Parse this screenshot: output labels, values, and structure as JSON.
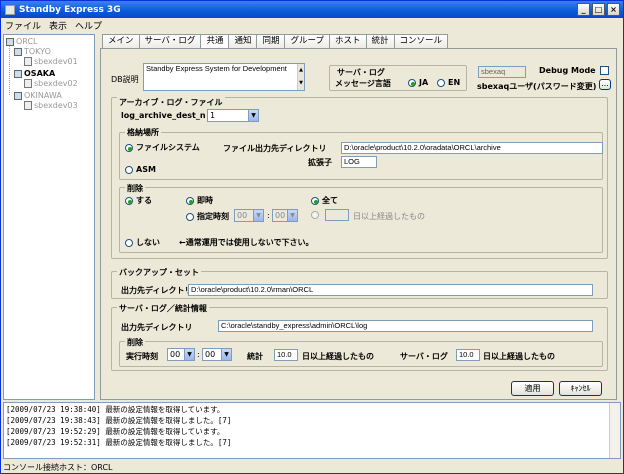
{
  "window": {
    "title": "Standby Express 3G",
    "controls": [
      "_",
      "□",
      "×"
    ]
  },
  "menu": [
    "ファイル",
    "表示",
    "ヘルプ"
  ],
  "tree": {
    "root": "ORCL",
    "nodes": [
      {
        "site": "TOKYO",
        "host": "sbexdev01",
        "active": false
      },
      {
        "site": "OSAKA",
        "host": "sbexdev02",
        "active": true
      },
      {
        "site": "OKINAWA",
        "host": "sbexdev03",
        "active": false
      }
    ]
  },
  "tabs": [
    "メイン",
    "サーバ・ログ",
    "共通",
    "通知",
    "同期",
    "グループ",
    "ホスト",
    "統計",
    "コンソール"
  ],
  "active_tab": "共通",
  "db_desc": {
    "label": "DB説明",
    "value": "Standby Express System for Development"
  },
  "server_log": {
    "label1": "サーバ・ログ",
    "label2": "メッセージ言語",
    "options": [
      "JA",
      "EN"
    ],
    "selected": "JA"
  },
  "user": {
    "value": "sbexaq",
    "label": "sbexaqユーザ(パスワード変更)",
    "button": "..."
  },
  "debug": {
    "label": "Debug Mode",
    "checked": false
  },
  "archive": {
    "title": "アーカイブ・ログ・ファイル",
    "dest_label": "log_archive_dest_n",
    "dest_value": "1",
    "storage_title": "格納場所",
    "fs_option": "ファイルシステム",
    "dir_label": "ファイル出力先ディレクトリ",
    "dir_value": "D:\\oracle\\product\\10.2.0\\oradata\\ORCL\\archive",
    "ext_label": "拡張子",
    "ext_value": "LOG",
    "asm_option": "ASM",
    "storage_selected": "ファイルシステム",
    "delete_title": "削除",
    "do_option": "する",
    "immediate_option": "即時",
    "timed_option": "指定時刻",
    "hour": "00",
    "minute": "00",
    "all_option": "全て",
    "days_suffix": "日以上経過したもの",
    "days_value": "",
    "no_option": "しない",
    "no_note": "←通常運用では使用しないで下さい。"
  },
  "backup": {
    "title": "バックアップ・セット",
    "dir_label": "出力先ディレクトリ",
    "dir_value": "D:\\oracle\\product\\10.2.0\\rman\\ORCL"
  },
  "serverlog_stats": {
    "title": "サーバ・ログ／統計情報",
    "dir_label": "出力先ディレクトリ",
    "dir_value": "C:\\oracle\\standby_express\\admin\\ORCL\\log",
    "delete_title": "削除",
    "time_label": "実行時刻",
    "hour": "00",
    "minute": "00",
    "stats_label": "統計",
    "stats_days": "10.0",
    "days_suffix": "日以上経過したもの",
    "slog_label": "サーバ・ログ",
    "slog_days": "10.0"
  },
  "buttons": {
    "apply": "適用",
    "cancel": "ｷｬﾝｾﾙ"
  },
  "log_lines": [
    "[2009/07/23 19:38:40] 最新の設定情報を取得しています。",
    "[2009/07/23 19:38:43] 最新の設定情報を取得しました。[7]",
    "[2009/07/23 19:52:29] 最新の設定情報を取得しています。",
    "[2009/07/23 19:52:31] 最新の設定情報を取得しました。[7]"
  ],
  "status": "コンソール接続ホスト：ORCL"
}
